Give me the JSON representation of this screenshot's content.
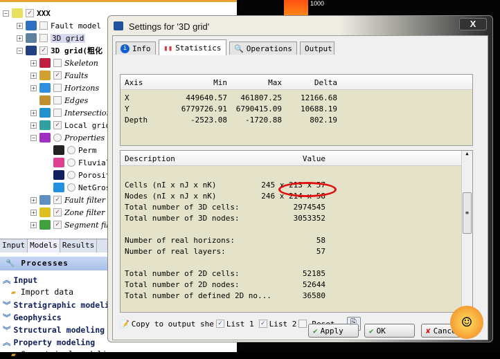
{
  "tree": [
    {
      "label": "XXX",
      "indent": 0,
      "exp": "-",
      "check": "checked",
      "bold": true,
      "italic": false,
      "color": "#e8e060"
    },
    {
      "label": "Fault model",
      "indent": 1,
      "exp": "+",
      "check": "unchecked",
      "bold": false,
      "italic": false,
      "color": "#3070c0"
    },
    {
      "label": "3D grid",
      "indent": 1,
      "exp": "+",
      "check": "unchecked",
      "bold": false,
      "italic": false,
      "selected": true,
      "color": "#6080a0"
    },
    {
      "label": "3D grid(粗化",
      "indent": 1,
      "exp": "-",
      "check": "checked",
      "bold": true,
      "italic": false,
      "color": "#204080"
    },
    {
      "label": "Skeleton",
      "indent": 2,
      "exp": "+",
      "check": "unchecked",
      "italic": true,
      "color": "#c02040"
    },
    {
      "label": "Faults",
      "indent": 2,
      "exp": "+",
      "check": "checked",
      "italic": true,
      "color": "#d0a030"
    },
    {
      "label": "Horizons",
      "indent": 2,
      "exp": "+",
      "check": "unchecked",
      "italic": true,
      "color": "#3090e0"
    },
    {
      "label": "Edges",
      "indent": 2,
      "exp": "",
      "check": "unchecked",
      "italic": true,
      "color": "#c09030"
    },
    {
      "label": "Intersections",
      "indent": 2,
      "exp": "+",
      "check": "unchecked",
      "italic": true,
      "color": "#2090d0"
    },
    {
      "label": "Local grid",
      "indent": 2,
      "exp": "+",
      "check": "checked",
      "italic": false,
      "color": "#30a0a0"
    },
    {
      "label": "Properties",
      "indent": 2,
      "exp": "-",
      "check": "radio",
      "italic": true,
      "color": "#a030c0"
    },
    {
      "label": "Perm",
      "indent": 3,
      "exp": "",
      "check": "radio",
      "italic": false,
      "color": "#222"
    },
    {
      "label": "Fluvial",
      "indent": 3,
      "exp": "",
      "check": "radio",
      "italic": false,
      "color": "#e04090"
    },
    {
      "label": "Porosity",
      "indent": 3,
      "exp": "",
      "check": "radio",
      "italic": false,
      "color": "#102060"
    },
    {
      "label": "NetGross",
      "indent": 3,
      "exp": "",
      "check": "radio",
      "italic": false,
      "color": "#2090e0"
    },
    {
      "label": "Fault filter",
      "indent": 2,
      "exp": "+",
      "check": "checked",
      "italic": true,
      "color": "#6090c0"
    },
    {
      "label": "Zone filter",
      "indent": 2,
      "exp": "+",
      "check": "checked",
      "italic": true,
      "color": "#e0c020"
    },
    {
      "label": "Segment filter",
      "indent": 2,
      "exp": "+",
      "check": "checked",
      "italic": true,
      "color": "#40a040"
    }
  ],
  "bottom_tabs": [
    "Input",
    "Models",
    "Results"
  ],
  "processes": {
    "title": "Processes",
    "items": [
      {
        "label": "Input",
        "chev": "︽",
        "sub": false
      },
      {
        "label": "Import data",
        "chev": "",
        "sub": true
      },
      {
        "label": "Stratigraphic modeling",
        "chev": "︾",
        "sub": false
      },
      {
        "label": "Geophysics",
        "chev": "︾",
        "sub": false
      },
      {
        "label": "Structural modeling",
        "chev": "︾",
        "sub": false
      },
      {
        "label": "Property modeling",
        "chev": "︽",
        "sub": false
      },
      {
        "label": "Geometrical modeling",
        "chev": "",
        "sub": true
      }
    ]
  },
  "colorbar_label": "1000",
  "dialog": {
    "title": "Settings for '3D grid'",
    "close": "X",
    "tabs": [
      "Info",
      "Statistics",
      "Operations",
      "Output"
    ],
    "active_tab": "Statistics",
    "axis_table": {
      "headers": [
        "Axis",
        "Min",
        "Max",
        "Delta"
      ],
      "rows": [
        [
          "X",
          "449640.57",
          "461807.25",
          "12166.68"
        ],
        [
          "Y",
          "6779726.91",
          "6790415.09",
          "10688.19"
        ],
        [
          "Depth",
          "-2523.08",
          "-1720.88",
          "802.19"
        ]
      ]
    },
    "desc_table": {
      "headers": [
        "Description",
        "Value"
      ],
      "rows": [
        [
          "",
          ""
        ],
        [
          "Cells (nI x nJ x nK)",
          "245 x 213 x 57"
        ],
        [
          "Nodes (nI x nJ x nK)",
          "246 x 214 x 58"
        ],
        [
          "Total number of 3D cells:",
          "2974545"
        ],
        [
          "Total number of 3D nodes:",
          "3053352"
        ],
        [
          "",
          ""
        ],
        [
          "Number of real horizons:",
          "58"
        ],
        [
          "Number of real layers:",
          "57"
        ],
        [
          "",
          ""
        ],
        [
          "Total number of 2D cells:",
          "52185"
        ],
        [
          "Total number of 2D nodes:",
          "52644"
        ],
        [
          "Total number of defined 2D no...",
          "36580"
        ]
      ]
    },
    "copy_label": "Copy to output she",
    "list1": "List 1",
    "list2": "List 2",
    "reset": "Reset",
    "list1_checked": true,
    "list2_checked": true,
    "reset_checked": false,
    "buttons": {
      "apply": "Apply",
      "ok": "OK",
      "cancel": "Cancel"
    },
    "annotation_color": "#e01010"
  }
}
